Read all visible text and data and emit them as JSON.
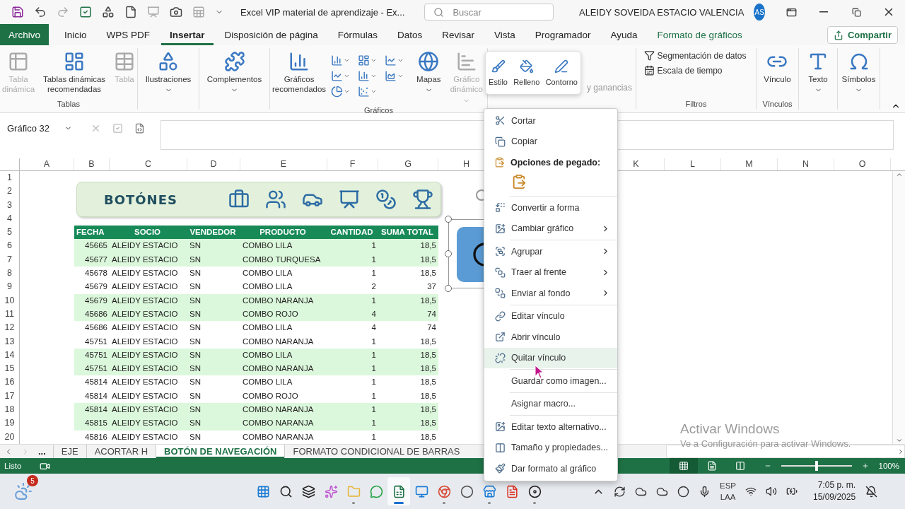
{
  "title_bar": {
    "title": "Excel VIP material de aprendizaje  -  Ex...",
    "search_placeholder": "Buscar",
    "user_name": "ALEIDY SOVEIDA ESTACIO VALENCIA",
    "avatar_initials": "AS"
  },
  "menu_tabs": [
    {
      "label": "Archivo",
      "selected": false
    },
    {
      "label": "Inicio",
      "selected": false
    },
    {
      "label": "WPS PDF",
      "selected": false
    },
    {
      "label": "Insertar",
      "selected": true
    },
    {
      "label": "Disposición de página",
      "selected": false
    },
    {
      "label": "Fórmulas",
      "selected": false
    },
    {
      "label": "Datos",
      "selected": false
    },
    {
      "label": "Revisar",
      "selected": false
    },
    {
      "label": "Vista",
      "selected": false
    },
    {
      "label": "Programador",
      "selected": false
    },
    {
      "label": "Ayuda",
      "selected": false
    },
    {
      "label": "Formato de gráficos",
      "selected": false
    }
  ],
  "share_button": "Compartir",
  "ribbon": {
    "groups": [
      {
        "label": "Tablas",
        "items": [
          {
            "kind": "large",
            "label": "Tabla dinámica",
            "disabled": true,
            "dropdown": false
          },
          {
            "kind": "large",
            "label": "Tablas dinámicas recomendadas",
            "disabled": false,
            "dropdown": false
          },
          {
            "kind": "large",
            "label": "Tabla",
            "disabled": true,
            "dropdown": false
          }
        ]
      },
      {
        "items": [
          {
            "kind": "large",
            "label": "Ilustraciones",
            "disabled": false,
            "dropdown": true
          }
        ]
      },
      {
        "items": [
          {
            "kind": "large",
            "label": "Complementos",
            "disabled": false,
            "dropdown": true
          }
        ]
      },
      {
        "label": "Gráficos",
        "items": [
          {
            "kind": "large",
            "label": "Gráficos recomendados",
            "disabled": false,
            "dropdown": false
          },
          {
            "kind": "gallery"
          },
          {
            "kind": "large",
            "label": "Mapas",
            "disabled": false,
            "dropdown": true
          },
          {
            "kind": "large",
            "label": "Gráfico dinámico",
            "disabled": true,
            "dropdown": true
          }
        ]
      },
      {
        "items": [
          {
            "kind": "small",
            "label": "y ganancias",
            "disabled": true
          }
        ]
      },
      {
        "label": "Filtros",
        "items": [
          {
            "kind": "small",
            "label": "Segmentación de datos",
            "disabled": false
          },
          {
            "kind": "small",
            "label": "Escala de tiempo",
            "disabled": false
          }
        ]
      },
      {
        "label": "Vínculos",
        "items": [
          {
            "kind": "large",
            "label": "Vínculo",
            "disabled": false,
            "dropdown": false
          }
        ]
      },
      {
        "items": [
          {
            "kind": "large",
            "label": "Texto",
            "disabled": false,
            "dropdown": true
          }
        ]
      },
      {
        "items": [
          {
            "kind": "large",
            "label": "Símbolos",
            "disabled": false,
            "dropdown": true
          }
        ]
      }
    ]
  },
  "mini_toolbar": [
    {
      "label": "Estilo"
    },
    {
      "label": "Relleno"
    },
    {
      "label": "Contorno"
    }
  ],
  "formula_bar": {
    "name_box": "Gráfico 32"
  },
  "sheet": {
    "column_headers": [
      "A",
      "B",
      "C",
      "D",
      "E",
      "F",
      "G",
      "H",
      "K",
      "L",
      "M",
      "N",
      "O"
    ],
    "row_numbers": [
      "1",
      "2",
      "3",
      "4",
      "5",
      "6",
      "7",
      "8",
      "9",
      "10",
      "11",
      "12",
      "13",
      "14",
      "15",
      "16",
      "17",
      "18",
      "19",
      "20"
    ],
    "banner": {
      "title": "BOTÓNES"
    },
    "table": {
      "columns": [
        "FECHA",
        "SOCIO",
        "VENDEDOR",
        "PRODUCTO",
        "CANTIDAD",
        "SUMA TOTAL"
      ],
      "rows": [
        {
          "shaded": true,
          "cells": [
            "45665",
            "ALEIDY ESTACIO",
            "SN",
            "COMBO LILA",
            "1",
            "18,5"
          ]
        },
        {
          "shaded": true,
          "cells": [
            "45677",
            "ALEIDY ESTACIO",
            "SN",
            "COMBO TURQUESA",
            "1",
            "18,5"
          ]
        },
        {
          "shaded": false,
          "cells": [
            "45678",
            "ALEIDY ESTACIO",
            "SN",
            "COMBO LILA",
            "1",
            "18,5"
          ]
        },
        {
          "shaded": false,
          "cells": [
            "45679",
            "ALEIDY ESTACIO",
            "SN",
            "COMBO LILA",
            "2",
            "37"
          ]
        },
        {
          "shaded": true,
          "cells": [
            "45679",
            "ALEIDY ESTACIO",
            "SN",
            "COMBO NARANJA",
            "1",
            "18,5"
          ]
        },
        {
          "shaded": true,
          "cells": [
            "45686",
            "ALEIDY ESTACIO",
            "SN",
            "COMBO ROJO",
            "4",
            "74"
          ]
        },
        {
          "shaded": false,
          "cells": [
            "45686",
            "ALEIDY ESTACIO",
            "SN",
            "COMBO LILA",
            "4",
            "74"
          ]
        },
        {
          "shaded": false,
          "cells": [
            "45751",
            "ALEIDY ESTACIO",
            "SN",
            "COMBO NARANJA",
            "1",
            "18,5"
          ]
        },
        {
          "shaded": true,
          "cells": [
            "45751",
            "ALEIDY ESTACIO",
            "SN",
            "COMBO LILA",
            "1",
            "18,5"
          ]
        },
        {
          "shaded": true,
          "cells": [
            "45751",
            "ALEIDY ESTACIO",
            "SN",
            "COMBO NARANJA",
            "1",
            "18,5"
          ]
        },
        {
          "shaded": false,
          "cells": [
            "45814",
            "ALEIDY ESTACIO",
            "SN",
            "COMBO LILA",
            "1",
            "18,5"
          ]
        },
        {
          "shaded": false,
          "cells": [
            "45814",
            "ALEIDY ESTACIO",
            "SN",
            "COMBO ROJO",
            "1",
            "18,5"
          ]
        },
        {
          "shaded": true,
          "cells": [
            "45814",
            "ALEIDY ESTACIO",
            "SN",
            "COMBO NARANJA",
            "1",
            "18,5"
          ]
        },
        {
          "shaded": true,
          "cells": [
            "45815",
            "ALEIDY ESTACIO",
            "SN",
            "COMBO NARANJA",
            "1",
            "18,5"
          ]
        },
        {
          "shaded": false,
          "cells": [
            "45816",
            "ALEIDY ESTACIO",
            "SN",
            "COMBO NARANJA",
            "1",
            "18,5"
          ]
        }
      ]
    }
  },
  "context_menu": [
    {
      "kind": "item",
      "label": "Cortar",
      "submenu": false,
      "selected": false
    },
    {
      "kind": "item",
      "label": "Copiar",
      "submenu": false,
      "selected": false
    },
    {
      "kind": "header",
      "label": "Opciones de pegado:"
    },
    {
      "kind": "paste"
    },
    {
      "kind": "separator"
    },
    {
      "kind": "item",
      "label": "Convertir a forma",
      "submenu": false,
      "selected": false
    },
    {
      "kind": "item",
      "label": "Cambiar gráfico",
      "submenu": true,
      "selected": false
    },
    {
      "kind": "separator"
    },
    {
      "kind": "item",
      "label": "Agrupar",
      "submenu": true,
      "selected": false
    },
    {
      "kind": "item",
      "label": "Traer al frente",
      "submenu": true,
      "selected": false
    },
    {
      "kind": "item",
      "label": "Enviar al fondo",
      "submenu": true,
      "selected": false
    },
    {
      "kind": "separator"
    },
    {
      "kind": "item",
      "label": "Editar vínculo",
      "submenu": false,
      "selected": false
    },
    {
      "kind": "item",
      "label": "Abrir vínculo",
      "submenu": false,
      "selected": false
    },
    {
      "kind": "item",
      "label": "Quitar vínculo",
      "submenu": false,
      "selected": true
    },
    {
      "kind": "separator"
    },
    {
      "kind": "item",
      "label": "Guardar como imagen...",
      "submenu": false,
      "selected": false
    },
    {
      "kind": "separator"
    },
    {
      "kind": "item",
      "label": "Asignar macro...",
      "submenu": false,
      "selected": false
    },
    {
      "kind": "separator"
    },
    {
      "kind": "item",
      "label": "Editar texto alternativo...",
      "submenu": false,
      "selected": false
    },
    {
      "kind": "item",
      "label": "Tamaño y propiedades...",
      "submenu": false,
      "selected": false
    },
    {
      "kind": "item",
      "label": "Dar formato al gráfico",
      "submenu": false,
      "selected": false
    }
  ],
  "sheet_tabs": {
    "overflow": "...",
    "tabs": [
      {
        "label": "EJE",
        "selected": false
      },
      {
        "label": "ACORTAR H",
        "selected": false
      },
      {
        "label": "BOTÓN DE NAVEGACIÓN",
        "selected": true
      },
      {
        "label": "FORMATO CONDICIONAL DE BARRAS",
        "selected": false
      }
    ]
  },
  "status_bar": {
    "status": "Listo",
    "views": [
      {
        "selected": true
      },
      {
        "selected": false
      },
      {
        "selected": false
      }
    ],
    "zoom": {
      "level": 0.5,
      "reading": "100%"
    }
  },
  "watermark": {
    "title": "Activar Windows",
    "subtitle": "Ve a Configuración para activar Windows."
  },
  "taskbar": {
    "weather_badge": "5",
    "apps": [
      {
        "running": false,
        "selected": false
      },
      {
        "running": false,
        "selected": false
      },
      {
        "running": false,
        "selected": false
      },
      {
        "running": false,
        "selected": false
      },
      {
        "running": true,
        "selected": false
      },
      {
        "running": false,
        "selected": false
      },
      {
        "running": true,
        "selected": true
      },
      {
        "running": false,
        "selected": false
      },
      {
        "running": true,
        "selected": false
      },
      {
        "running": false,
        "selected": false
      },
      {
        "running": true,
        "selected": false
      },
      {
        "running": false,
        "selected": false
      },
      {
        "running": true,
        "selected": false
      }
    ],
    "language": "ESP",
    "layout": "LAA",
    "time": "7:05 p. m.",
    "date": "15/09/2025"
  }
}
